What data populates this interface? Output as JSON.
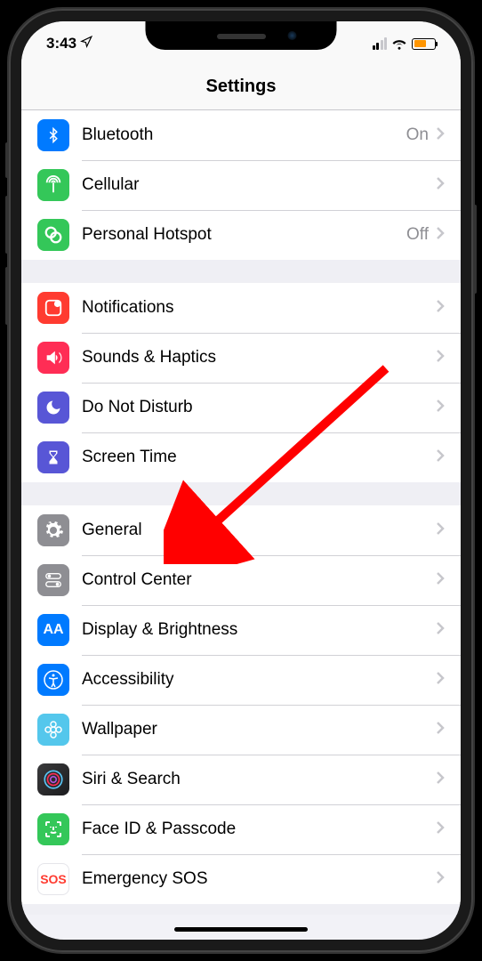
{
  "status": {
    "time": "3:43",
    "location_icon": "location-arrow",
    "signal_strength": 2,
    "wifi_strength": 3,
    "battery_level": 60,
    "battery_low_power": true
  },
  "header": {
    "title": "Settings"
  },
  "sections": [
    {
      "rows": [
        {
          "id": "bluetooth",
          "label": "Bluetooth",
          "value": "On",
          "icon": "bluetooth-icon",
          "color": "#007aff"
        },
        {
          "id": "cellular",
          "label": "Cellular",
          "value": "",
          "icon": "antenna-icon",
          "color": "#34c759"
        },
        {
          "id": "hotspot",
          "label": "Personal Hotspot",
          "value": "Off",
          "icon": "link-icon",
          "color": "#34c759"
        }
      ]
    },
    {
      "rows": [
        {
          "id": "notifications",
          "label": "Notifications",
          "value": "",
          "icon": "notification-badge-icon",
          "color": "#ff3b30"
        },
        {
          "id": "sounds",
          "label": "Sounds & Haptics",
          "value": "",
          "icon": "speaker-icon",
          "color": "#ff2d55"
        },
        {
          "id": "dnd",
          "label": "Do Not Disturb",
          "value": "",
          "icon": "moon-icon",
          "color": "#5856d6"
        },
        {
          "id": "screentime",
          "label": "Screen Time",
          "value": "",
          "icon": "hourglass-icon",
          "color": "#5856d6"
        }
      ]
    },
    {
      "rows": [
        {
          "id": "general",
          "label": "General",
          "value": "",
          "icon": "gear-icon",
          "color": "#8e8e93"
        },
        {
          "id": "controlcenter",
          "label": "Control Center",
          "value": "",
          "icon": "switches-icon",
          "color": "#8e8e93"
        },
        {
          "id": "display",
          "label": "Display & Brightness",
          "value": "",
          "icon": "aa-icon",
          "color": "#007aff"
        },
        {
          "id": "accessibility",
          "label": "Accessibility",
          "value": "",
          "icon": "accessibility-icon",
          "color": "#007aff"
        },
        {
          "id": "wallpaper",
          "label": "Wallpaper",
          "value": "",
          "icon": "flower-icon",
          "color": "#54c7ec"
        },
        {
          "id": "siri",
          "label": "Siri & Search",
          "value": "",
          "icon": "siri-icon",
          "color": "#1c1c1e"
        },
        {
          "id": "faceid",
          "label": "Face ID & Passcode",
          "value": "",
          "icon": "faceid-icon",
          "color": "#34c759"
        },
        {
          "id": "sos",
          "label": "Emergency SOS",
          "value": "",
          "icon": "sos-icon",
          "color": "#ffffff"
        }
      ]
    }
  ],
  "annotation": {
    "type": "arrow",
    "target": "general",
    "color": "#ff0000"
  },
  "icon_text": {
    "aa": "AA",
    "sos": "SOS"
  }
}
